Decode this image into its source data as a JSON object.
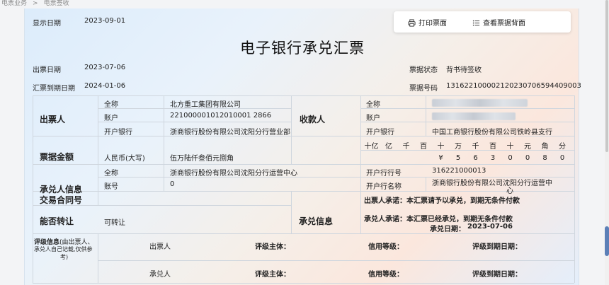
{
  "breadcrumb": {
    "items": [
      "电票业务",
      ">",
      "电票签收"
    ]
  },
  "toolbar": {
    "print_label": "打印票面",
    "view_back_label": "查看票据背面"
  },
  "bill": {
    "title": "电子银行承兑汇票",
    "display_date_label": "显示日期",
    "display_date": "2023-09-01",
    "issue_date_label": "出票日期",
    "issue_date": "2023-07-06",
    "due_date_label": "汇票到期日期",
    "due_date": "2024-01-06",
    "status_label": "票据状态",
    "status": "背书待签收",
    "bill_no_label": "票据号码",
    "bill_no": "131622100002120230706594409003",
    "drawer": {
      "section_label": "出票人",
      "name_label": "全称",
      "name": "北方重工集团有限公司",
      "account_label": "账户",
      "account": "221000001012010001 2866",
      "bank_label": "开户银行",
      "bank": "浙商银行股份有限公司沈阳分行营业部"
    },
    "payee": {
      "section_label": "收款人",
      "name_label": "全称",
      "account_label": "账户",
      "bank_label": "开户银行",
      "bank": "中国工商银行股份有限公司铁岭县支行"
    },
    "amount": {
      "section_label": "票据金额",
      "currency_label": "人民币(大写)",
      "amount_words": "伍万陆仟叁佰元捌角",
      "digit_headers": [
        "十亿",
        "亿",
        "千",
        "百",
        "十",
        "万",
        "千",
        "百",
        "十",
        "元",
        "角",
        "分"
      ],
      "digits": [
        "",
        "",
        "",
        "",
        "¥",
        "5",
        "6",
        "3",
        "0",
        "0",
        "8",
        "0"
      ]
    },
    "acceptor": {
      "section_label": "承兑人信息",
      "name_label": "全称",
      "name": "浙商银行股份有限公司沈阳分行运营中心",
      "account_label": "账号",
      "account": "0",
      "bank_no_label": "开户行行号",
      "bank_no": "316221000013",
      "bank_name_label": "开户行名称",
      "bank_name_line1": "浙商银行股份有限公司沈阳分行运营中",
      "bank_name_line2": "心"
    },
    "contract_label": "交易合同号",
    "transfer_label": "能否转让",
    "transfer_value": "可转让",
    "accept_info_label": "承兑信息",
    "drawer_promise": "出票人承诺：本汇票请予以承兑，到期无条件付款",
    "acceptor_promise": "承兑人承诺：本汇票已经承兑，到期无条件付款",
    "accept_date_label": "承兑日期：",
    "accept_date": "2023-07-06",
    "rating": {
      "label": "评级信息",
      "note1": "(由出票人、",
      "note2": "承兑人自己记载,仅供参",
      "note3": "考)",
      "row1_party": "出票人",
      "row2_party": "承兑人",
      "subject_label": "评级主体：",
      "level_label": "信用等级：",
      "expiry_label": "评级到期日期："
    }
  }
}
